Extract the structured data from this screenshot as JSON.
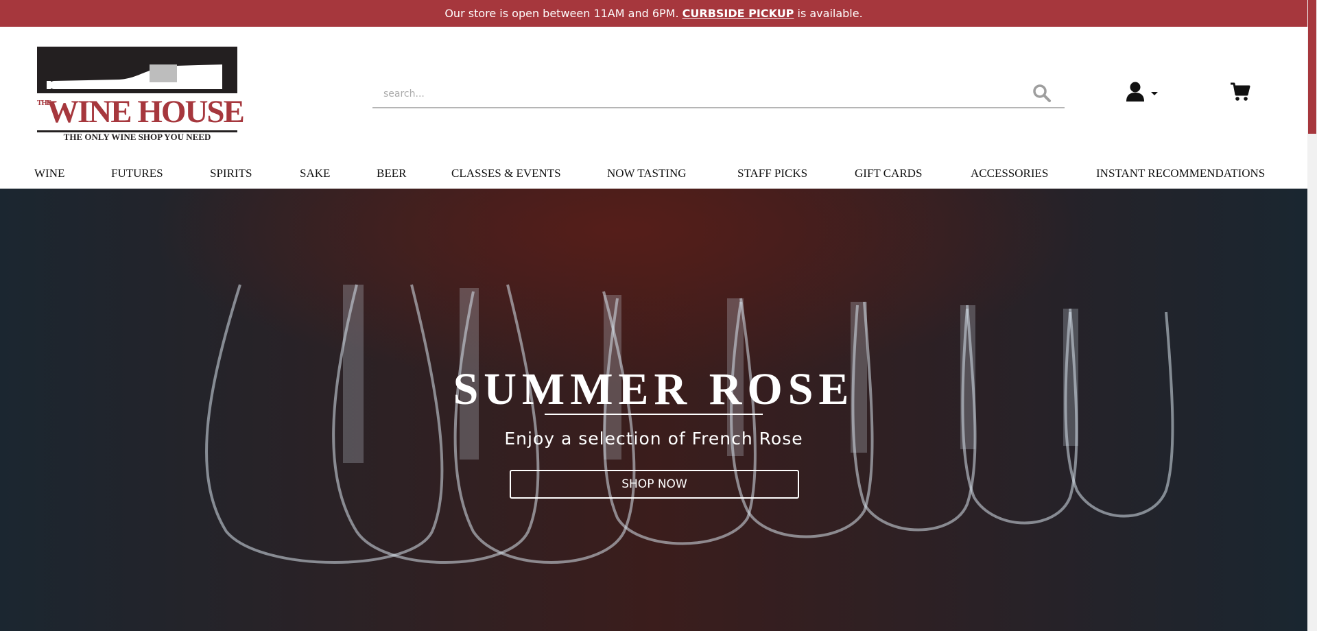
{
  "announcement": {
    "before": "Our store is open between 11AM and 6PM.",
    "link": "CURBSIDE PICKUP",
    "after": "is available."
  },
  "logo": {
    "the": "THE",
    "name": "WINE HOUSE",
    "tagline": "THE ONLY WINE SHOP YOU NEED"
  },
  "search": {
    "placeholder": "search...",
    "icon": "search-icon"
  },
  "header_icons": {
    "account": "user-icon",
    "account_caret": "caret-down-icon",
    "cart": "shopping-cart-icon"
  },
  "nav": [
    "WINE",
    "FUTURES",
    "SPIRITS",
    "SAKE",
    "BEER",
    "CLASSES & EVENTS",
    "NOW TASTING",
    "STAFF PICKS",
    "GIFT CARDS",
    "ACCESSORIES",
    "INSTANT RECOMMENDATIONS"
  ],
  "hero": {
    "title": "SUMMER ROSE",
    "subtitle": "Enjoy a selection of French Rose",
    "button": "SHOP NOW"
  },
  "colors": {
    "brand": "#a6373d",
    "logo_dark": "#231f20"
  }
}
